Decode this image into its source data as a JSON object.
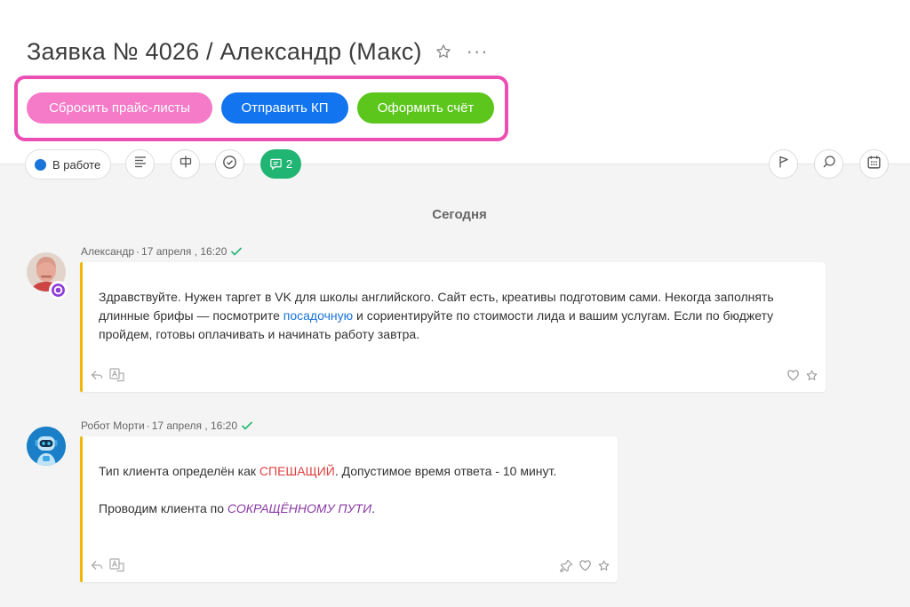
{
  "header": {
    "title": "Заявка № 4026 / Александр (Макс)",
    "more_label": "···"
  },
  "actions": {
    "reset_price_lists": "Сбросить прайс-листы",
    "send_offer": "Отправить КП",
    "make_invoice": "Оформить счёт"
  },
  "toolbar": {
    "status_label": "В работе",
    "status_color": "#1a73d9",
    "chat_count": "2",
    "icons": [
      "list-icon",
      "currency-icon",
      "check-circle-icon",
      "chat-icon",
      "flag-icon",
      "search-icon",
      "calendar-icon"
    ]
  },
  "feed": {
    "day_label": "Сегодня",
    "messages": [
      {
        "author": "Александр",
        "date": "17 апреля , 16:20",
        "text_before_link": "Здравствуйте. Нужен таргет в VK для школы английского. Сайт есть, креативы подготовим сами. Некогда заполнять длинные брифы — посмотрите ",
        "link_text": "посадочную",
        "text_after_link": " и сориентируйте по стоимости лида и вашим услугам. Если по бюджету пройдем, готовы оплачивать и начинать работу завтра."
      },
      {
        "author": "Робот Морти",
        "date": "17 апреля , 16:20",
        "line1_before": "Тип клиента определён как ",
        "line1_highlight": "СПЕШАЩИЙ",
        "line1_after": ". Допустимое время ответа - 10 минут.",
        "line2_before": "Проводим клиента по ",
        "line2_highlight": "СОКРАЩЁННОМУ ПУТИ",
        "line2_after": "."
      }
    ]
  },
  "colors": {
    "highlight_border": "#ec4fb3",
    "pink_button": "#f57ac7",
    "blue_button": "#1274ee",
    "green_button": "#5cc61c",
    "chat_green": "#21b573",
    "bubble_accent": "#f2b705"
  }
}
